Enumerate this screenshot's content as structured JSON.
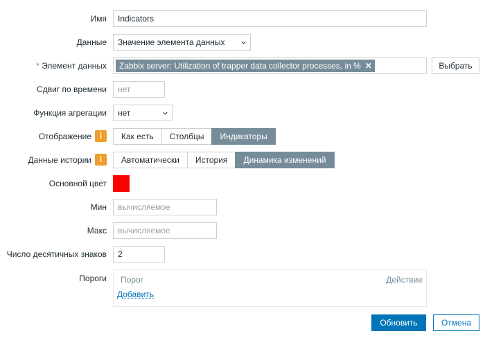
{
  "form": {
    "name": {
      "label": "Имя",
      "value": "Indicators"
    },
    "data": {
      "label": "Данные",
      "value": "Значение элемента данных"
    },
    "item": {
      "required_mark": "*",
      "label": "Элемент данных",
      "tag": "Zabbix server: Utilization of trapper data collector processes, in %",
      "remove_glyph": "✕",
      "select_button": "Выбрать"
    },
    "time_shift": {
      "label": "Сдвиг по времени",
      "placeholder": "нет"
    },
    "aggregation": {
      "label": "Функция агрегации",
      "value": "нет"
    },
    "display": {
      "label": "Отображение",
      "info": "i",
      "options": [
        "Как есть",
        "Столбцы",
        "Индикаторы"
      ],
      "selected": "Индикаторы"
    },
    "history": {
      "label": "Данные истории",
      "info": "i",
      "options": [
        "Автоматически",
        "История",
        "Динамика изменений"
      ],
      "selected": "Динамика изменений"
    },
    "base_color": {
      "label": "Основной цвет",
      "color": "#FF0000"
    },
    "min": {
      "label": "Мин",
      "placeholder": "вычисляемое"
    },
    "max": {
      "label": "Макс",
      "placeholder": "вычисляемое"
    },
    "decimals": {
      "label": "Число десятичных знаков",
      "value": "2"
    },
    "thresholds": {
      "label": "Пороги",
      "col_threshold": "Порог",
      "col_action": "Действие",
      "add_link": "Добавить"
    }
  },
  "footer": {
    "update_button": "Обновить",
    "cancel_button": "Отмена"
  },
  "colors": {
    "accent": "#0275B8",
    "segment_active": "#768D99",
    "info_badge": "#F09D2B",
    "required": "#E45959"
  }
}
